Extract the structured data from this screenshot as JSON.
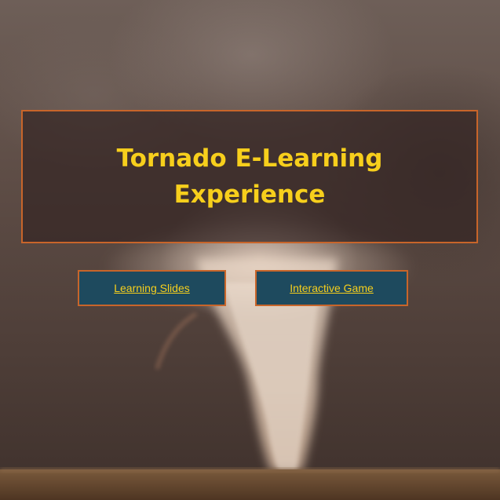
{
  "page": {
    "title_line1": "Tornado E-Learning",
    "title_line2": "Experience"
  },
  "nav": {
    "slides_label": "Learning Slides",
    "game_label": "Interactive Game"
  },
  "colors": {
    "accent_text": "#f7cf1c",
    "border": "#c8652a",
    "button_bg": "#1e4a5e"
  },
  "background": {
    "icon": "tornado-photo"
  }
}
